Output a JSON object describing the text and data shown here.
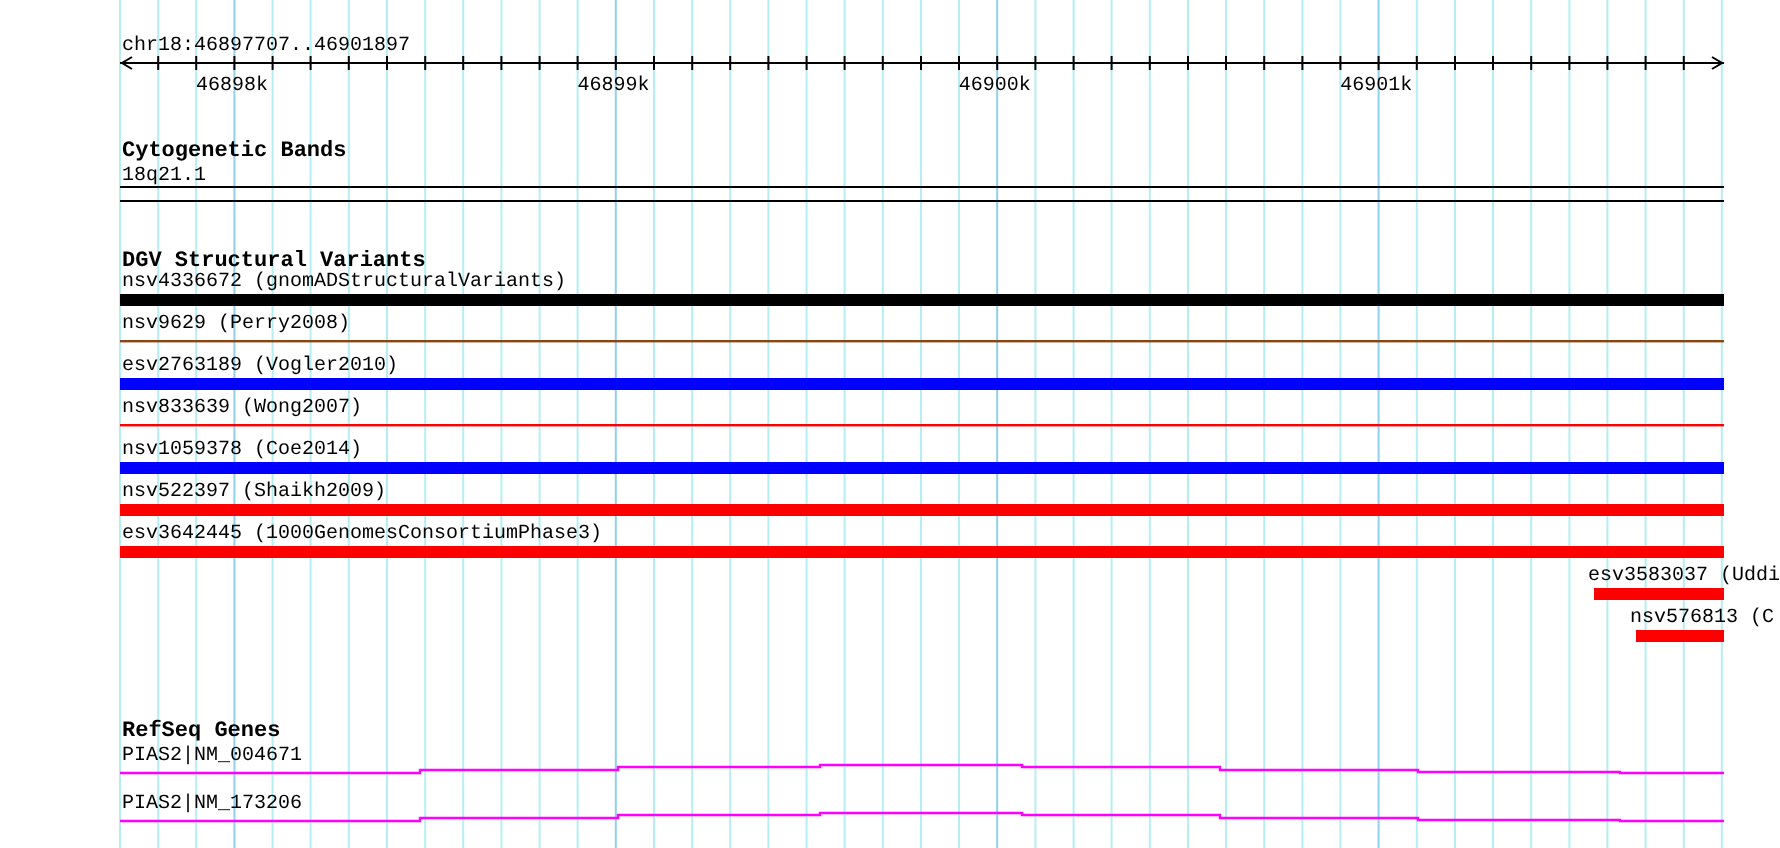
{
  "location": "chr18:46897707..46901897",
  "ruler": {
    "tick_labels": [
      "46898k",
      "46899k",
      "46900k",
      "46901k"
    ]
  },
  "tracks": [
    {
      "kind": "cytoband",
      "title": "Cytogenetic Bands",
      "features": [
        {
          "label": "18q21.1"
        }
      ]
    },
    {
      "kind": "variants",
      "title": "DGV Structural Variants",
      "features": [
        {
          "label": "nsv4336672 (gnomADStructuralVariants)",
          "color": "#000000",
          "kind": "bar"
        },
        {
          "label": "nsv9629 (Perry2008)",
          "color": "#8b4513",
          "kind": "line"
        },
        {
          "label": "esv2763189 (Vogler2010)",
          "color": "#0000ff",
          "kind": "bar"
        },
        {
          "label": "nsv833639 (Wong2007)",
          "color": "#ff0000",
          "kind": "line"
        },
        {
          "label": "nsv1059378 (Coe2014)",
          "color": "#0000ff",
          "kind": "bar"
        },
        {
          "label": "nsv522397 (Shaikh2009)",
          "color": "#ff0000",
          "kind": "bar"
        },
        {
          "label": "esv3642445 (1000GenomesConsortiumPhase3)",
          "color": "#ff0000",
          "kind": "bar"
        },
        {
          "label": "esv3583037 (Uddi",
          "color": "#ff0000",
          "kind": "stub"
        },
        {
          "label": "nsv576813 (C",
          "color": "#ff0000",
          "kind": "stub"
        }
      ]
    },
    {
      "kind": "genes",
      "title": "RefSeq Genes",
      "features": [
        {
          "label": "PIAS2|NM_004671"
        },
        {
          "label": "PIAS2|NM_173206"
        }
      ]
    }
  ]
}
